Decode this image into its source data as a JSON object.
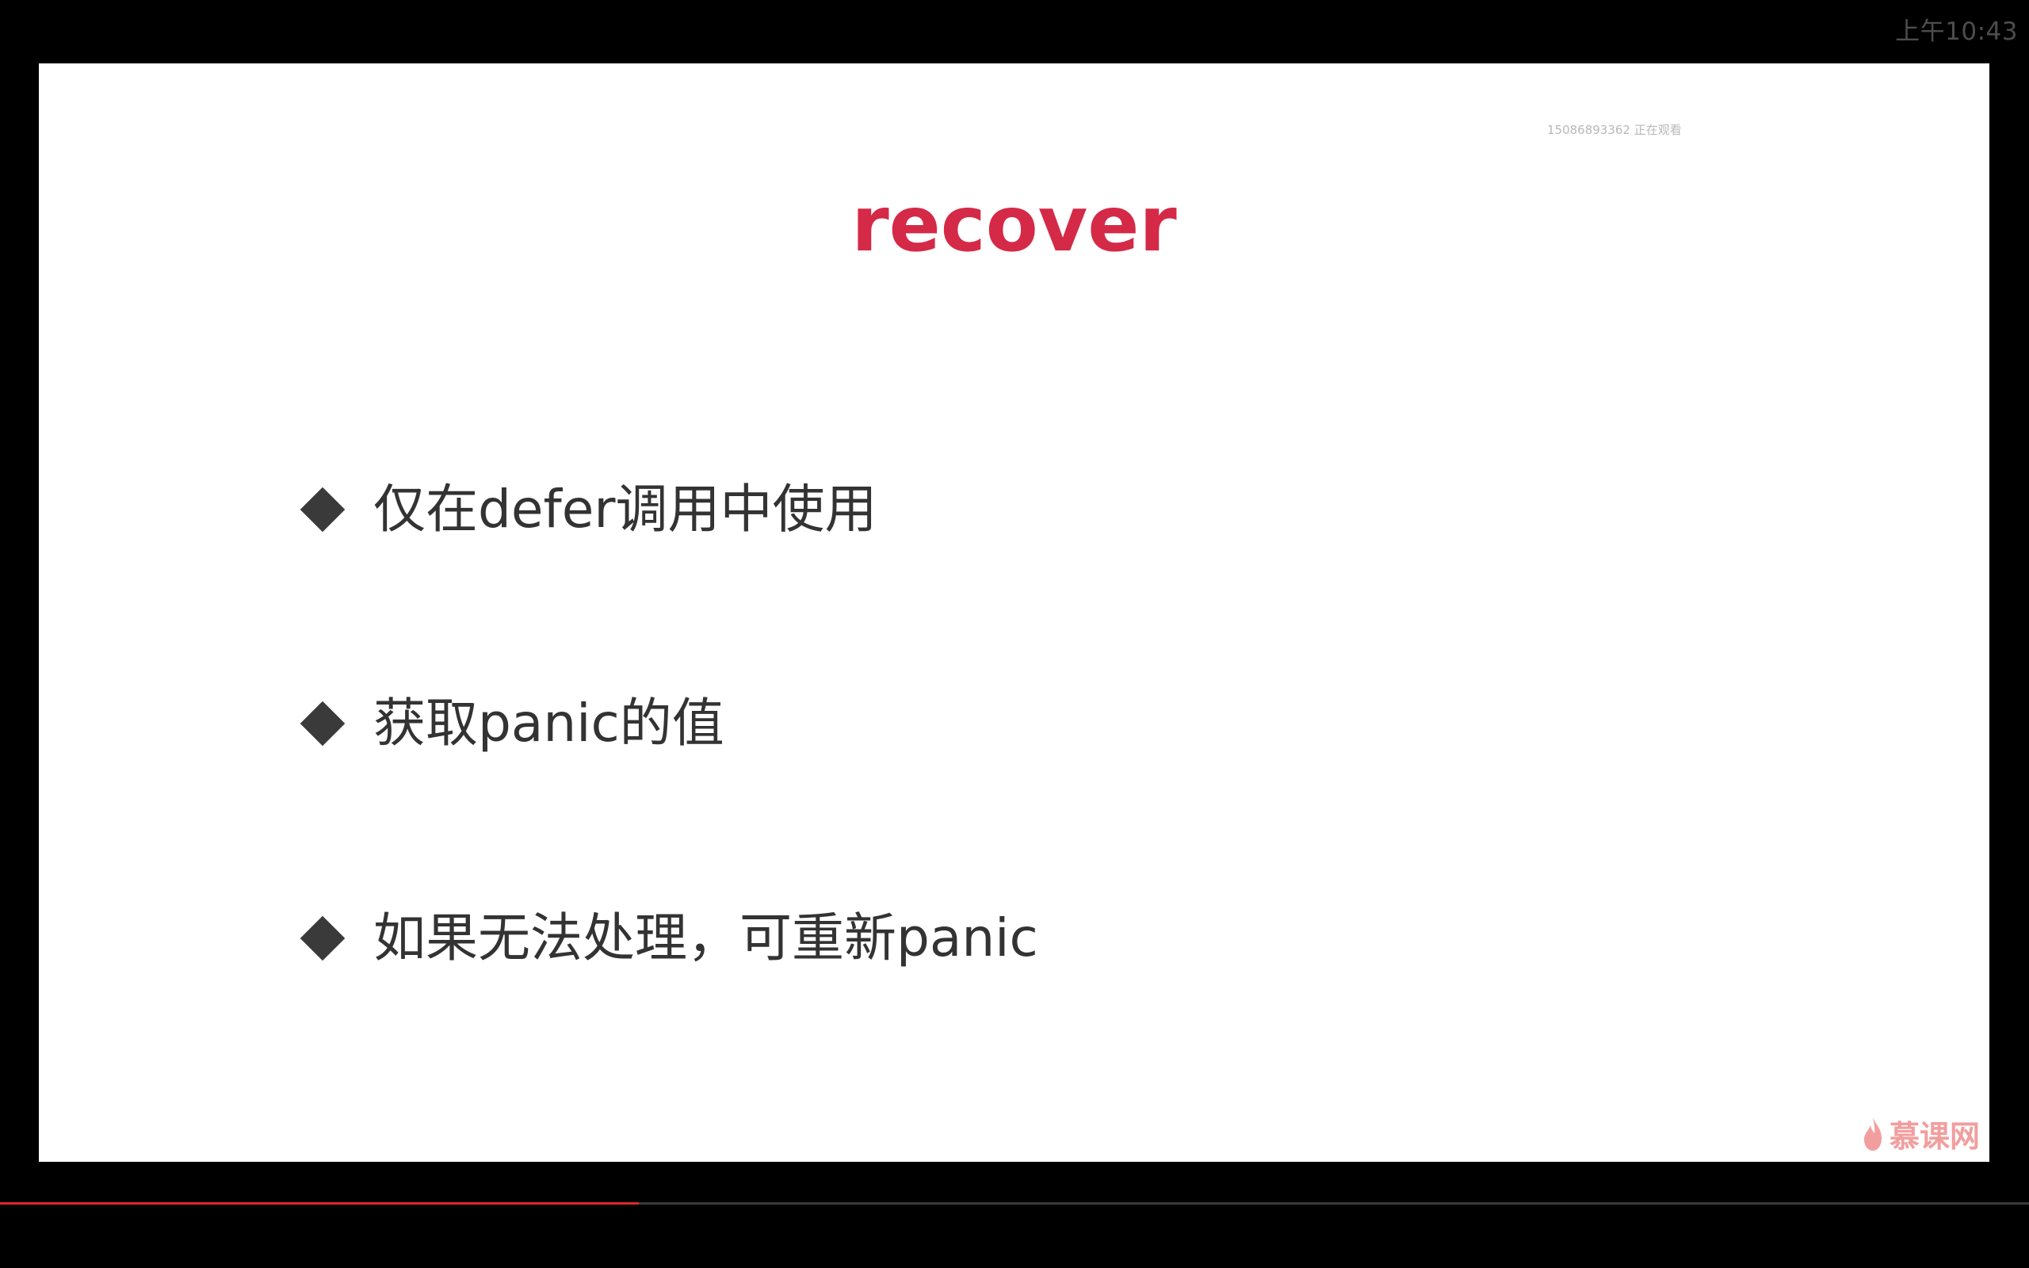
{
  "status_bar": {
    "time": "上午10:43"
  },
  "slide": {
    "watching_label": "15086893362 正在观看",
    "title": "recover",
    "title_color": "#d42a47",
    "bullets": [
      {
        "icon": "diamond-icon",
        "text": "仅在defer调用中使用"
      },
      {
        "icon": "diamond-icon",
        "text": "获取panic的值"
      },
      {
        "icon": "diamond-icon",
        "text": "如果无法处理，可重新panic"
      }
    ],
    "logo": {
      "icon": "flame-icon",
      "text": "慕课网"
    }
  },
  "player": {
    "progress_percent": 31.5,
    "progress_color": "#e0262c"
  }
}
